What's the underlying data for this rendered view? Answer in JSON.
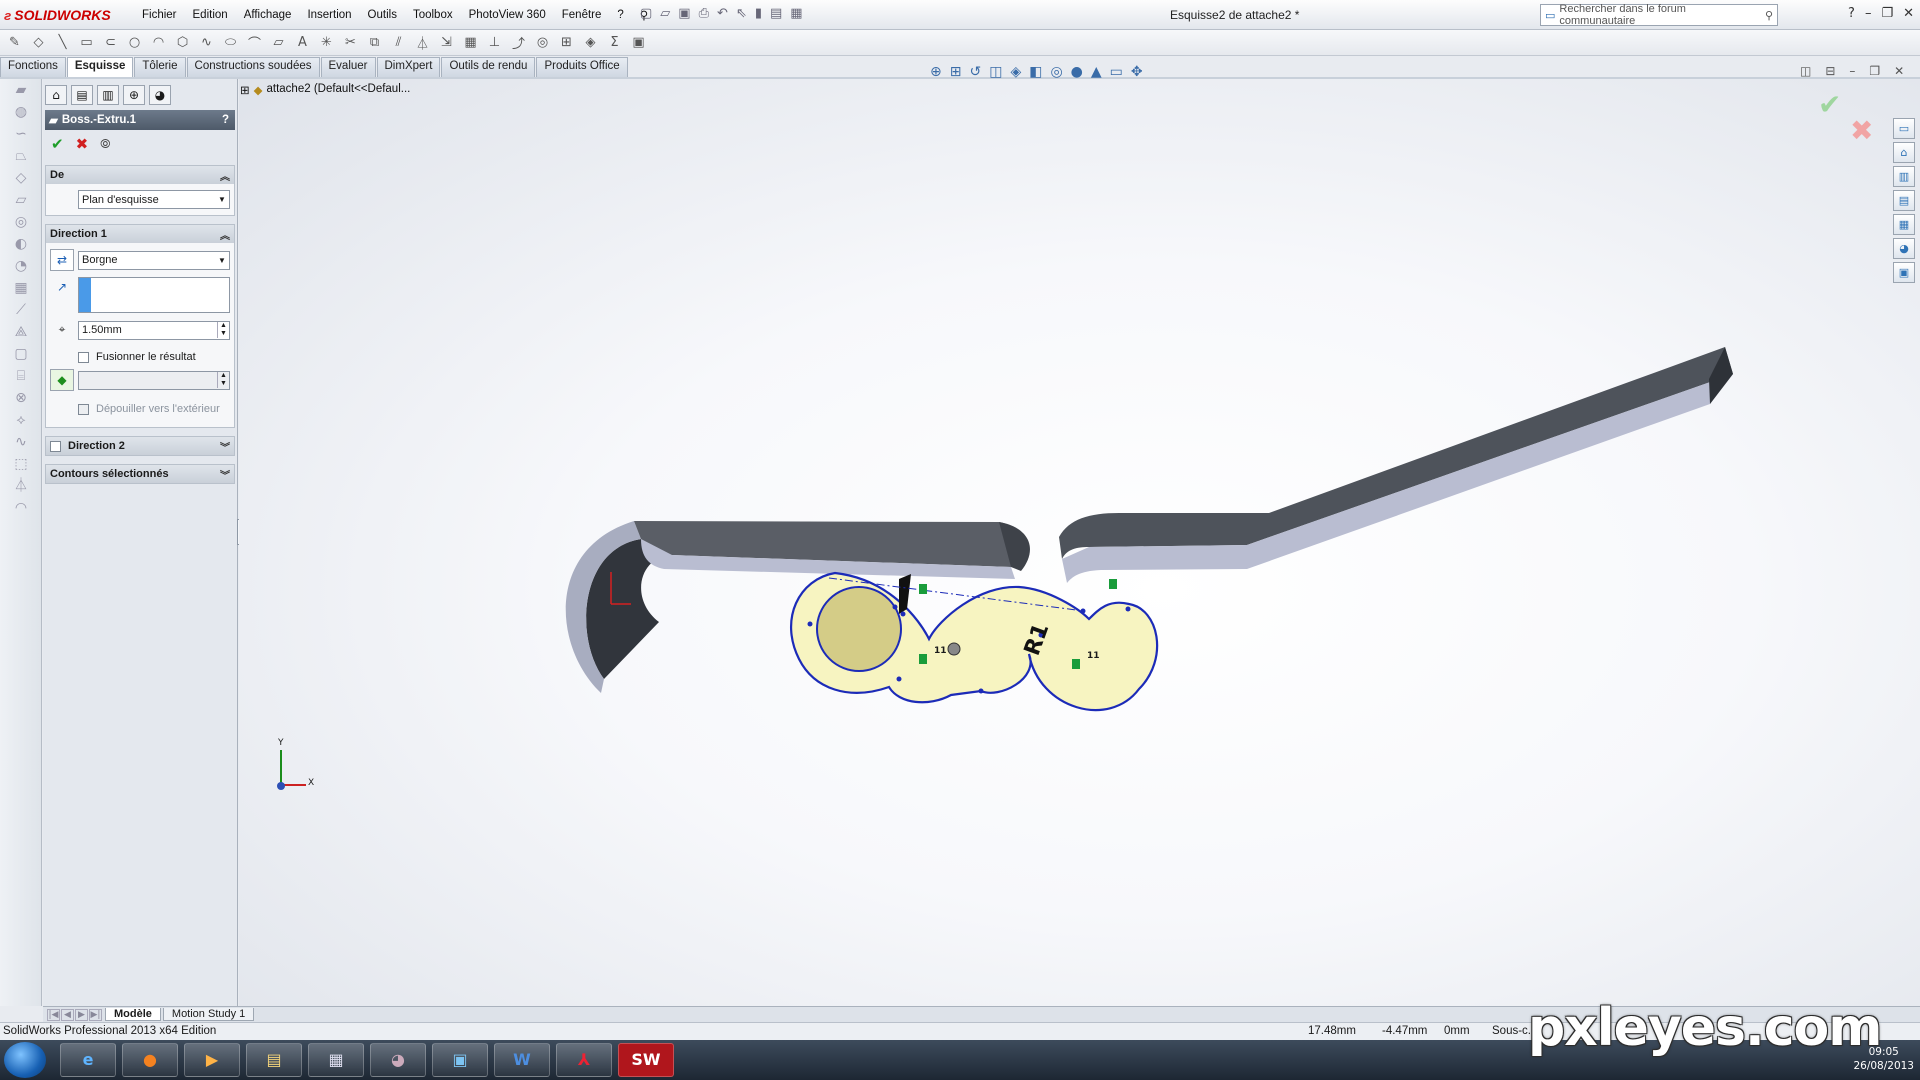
{
  "app": {
    "logo": "SOLIDWORKS",
    "doc_title": "Esquisse2 de attache2 *",
    "search_placeholder": "Rechercher dans le forum communautaire"
  },
  "menu": [
    "Fichier",
    "Edition",
    "Affichage",
    "Insertion",
    "Outils",
    "Toolbox",
    "PhotoView 360",
    "Fenêtre",
    "?"
  ],
  "tabs": [
    {
      "label": "Fonctions",
      "active": false
    },
    {
      "label": "Esquisse",
      "active": true
    },
    {
      "label": "Tôlerie",
      "active": false
    },
    {
      "label": "Constructions soudées",
      "active": false
    },
    {
      "label": "Evaluer",
      "active": false
    },
    {
      "label": "DimXpert",
      "active": false
    },
    {
      "label": "Outils de rendu",
      "active": false
    },
    {
      "label": "Produits Office",
      "active": false
    }
  ],
  "property_manager": {
    "title": "Boss.-Extru.1",
    "help": "?",
    "from_group": {
      "label": "De",
      "select_value": "Plan d'esquisse"
    },
    "direction1": {
      "label": "Direction 1",
      "end_condition": "Borgne",
      "depth": "1.50mm",
      "merge_label": "Fusionner le résultat",
      "draft_label": "Dépouiller vers l'extérieur"
    },
    "direction2": {
      "label": "Direction 2"
    },
    "contours": {
      "label": "Contours sélectionnés"
    }
  },
  "viewport": {
    "tree_label": "attache2  (Default<<Defaul...",
    "dimension_label": "R1",
    "relation_labels": [
      "11",
      "11"
    ],
    "axis_x": "X",
    "axis_y": "Y"
  },
  "bottom_tabs": [
    {
      "label": "Modèle",
      "active": true
    },
    {
      "label": "Motion Study 1",
      "active": false
    }
  ],
  "status": {
    "product": "SolidWorks Professional 2013 x64 Edition",
    "x": "17.48mm",
    "y": "-4.47mm",
    "z": "0mm",
    "mode": "Sous-c..."
  },
  "taskbar": {
    "date": "26/08/2013",
    "time": "09:05"
  },
  "watermark": "pxleyes.com",
  "colors": {
    "sketch_fill": "#f6f2b6",
    "sketch_line": "#1c2bb8",
    "part_dark": "#50545c",
    "part_light": "#b8bdd0",
    "accent_red": "#d12020",
    "accept_green": "#1e9e2a"
  }
}
